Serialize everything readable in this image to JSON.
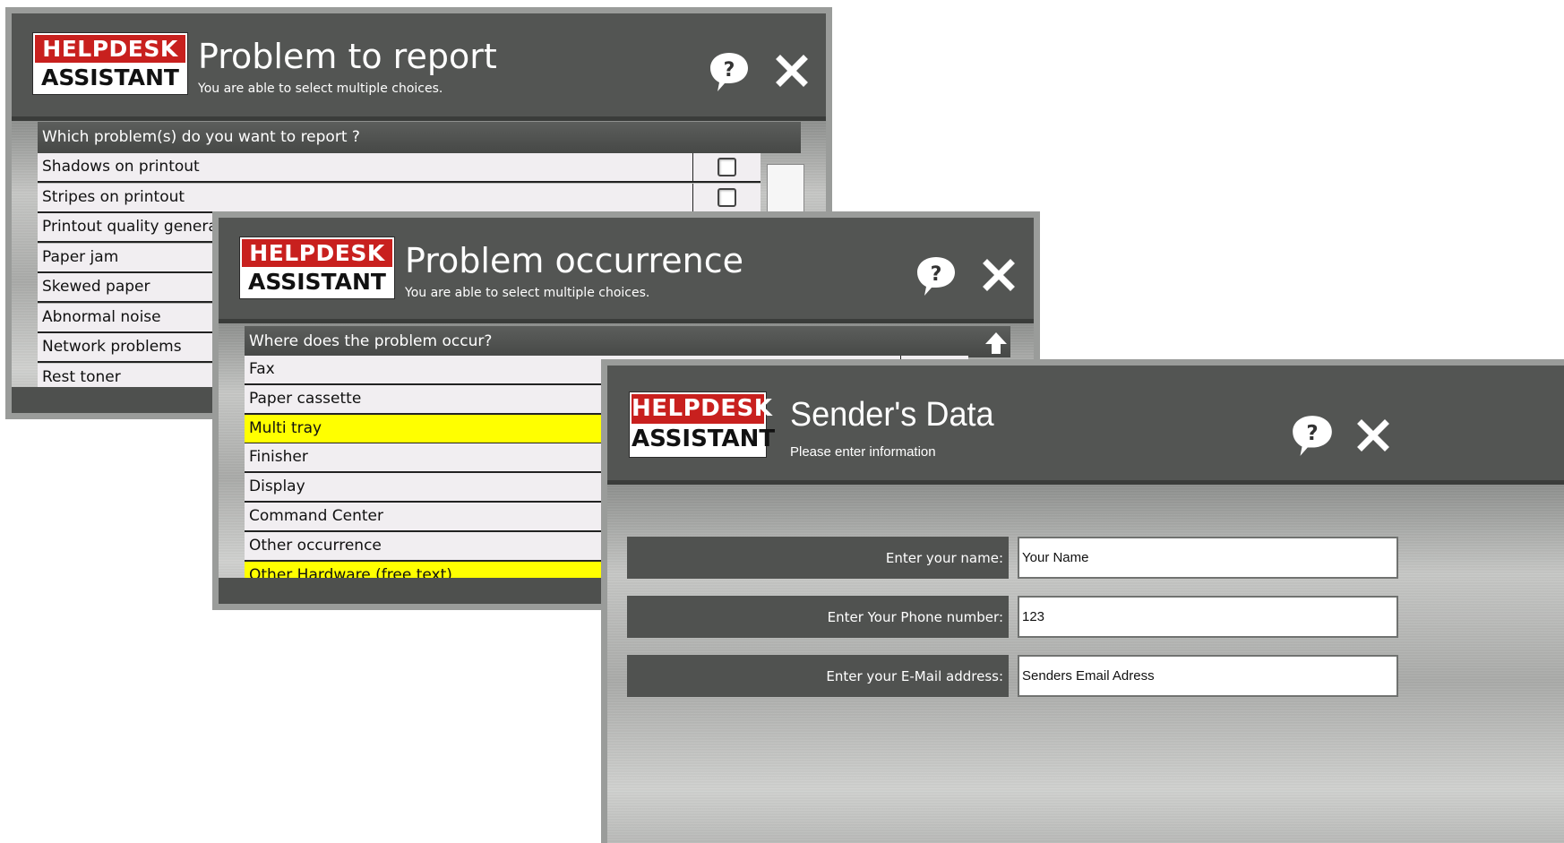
{
  "logo": {
    "line1": "HELPDESK",
    "line2": "ASSISTANT"
  },
  "window1": {
    "title": "Problem to report",
    "subtitle": "You are able to select multiple choices.",
    "question": "Which problem(s) do you want to report ?",
    "items": [
      {
        "label": "Shadows on printout",
        "checked": false
      },
      {
        "label": "Stripes on printout",
        "checked": false
      },
      {
        "label": "Printout quality generally bad",
        "checked": false
      },
      {
        "label": "Paper jam",
        "checked": false
      },
      {
        "label": "Skewed paper",
        "checked": false
      },
      {
        "label": "Abnormal noise",
        "checked": false
      },
      {
        "label": "Network problems",
        "checked": false
      },
      {
        "label": "Rest toner",
        "checked": false
      }
    ]
  },
  "window2": {
    "title": "Problem occurrence",
    "subtitle": "You are able to select multiple choices.",
    "question": "Where does the problem occur?",
    "items": [
      {
        "label": "Fax",
        "selected": false
      },
      {
        "label": "Paper cassette",
        "selected": false
      },
      {
        "label": "Multi tray",
        "selected": true
      },
      {
        "label": "Finisher",
        "selected": false
      },
      {
        "label": "Display",
        "selected": false
      },
      {
        "label": "Command Center",
        "selected": false
      },
      {
        "label": "Other occurrence",
        "selected": false
      },
      {
        "label": "Other Hardware (free text)",
        "selected": true
      }
    ]
  },
  "window3": {
    "title": "Sender's Data",
    "subtitle": "Please enter information",
    "fields": [
      {
        "label": "Enter your name:",
        "value": "Your Name"
      },
      {
        "label": "Enter Your Phone number:",
        "value": "123"
      },
      {
        "label": "Enter your E-Mail address:",
        "value": "Senders Email Adress"
      }
    ]
  },
  "colors": {
    "selected_row": "#ffff00",
    "logo_red": "#c8201e",
    "panel": "#535553"
  }
}
